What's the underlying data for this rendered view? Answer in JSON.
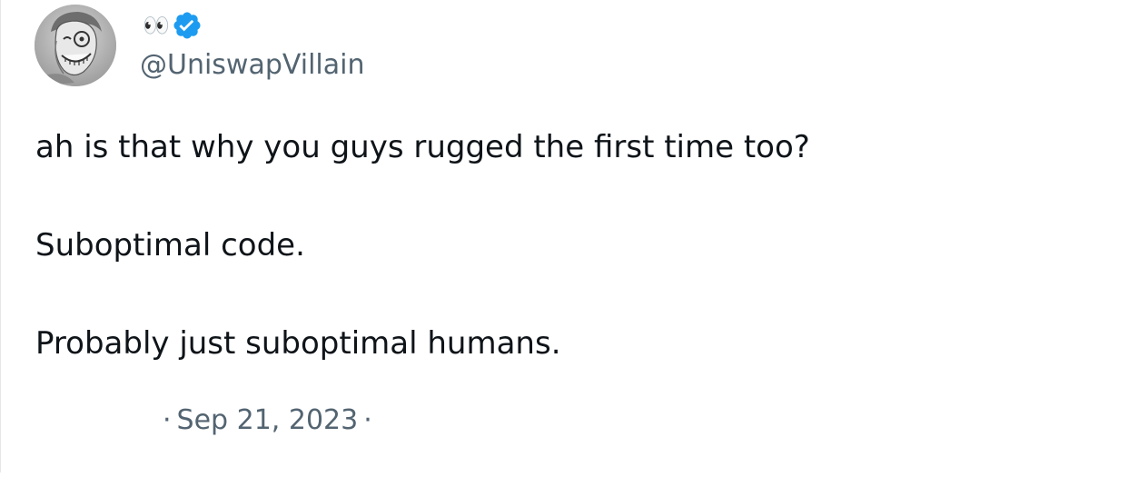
{
  "author": {
    "display_name": "👀",
    "handle": "@UniswapVillain",
    "verified": true,
    "avatar_icon": "joker-avatar-icon"
  },
  "tweet": {
    "paragraphs": [
      "ah is that why you guys rugged the first time too?",
      "Suboptimal code.",
      "Probably just suboptimal humans."
    ]
  },
  "meta": {
    "separator_left": "·",
    "date": "Sep 21, 2023",
    "separator_right": "·"
  },
  "colors": {
    "text_primary": "#0f1419",
    "text_secondary": "#536471",
    "verified_blue": "#1d9bf0"
  }
}
